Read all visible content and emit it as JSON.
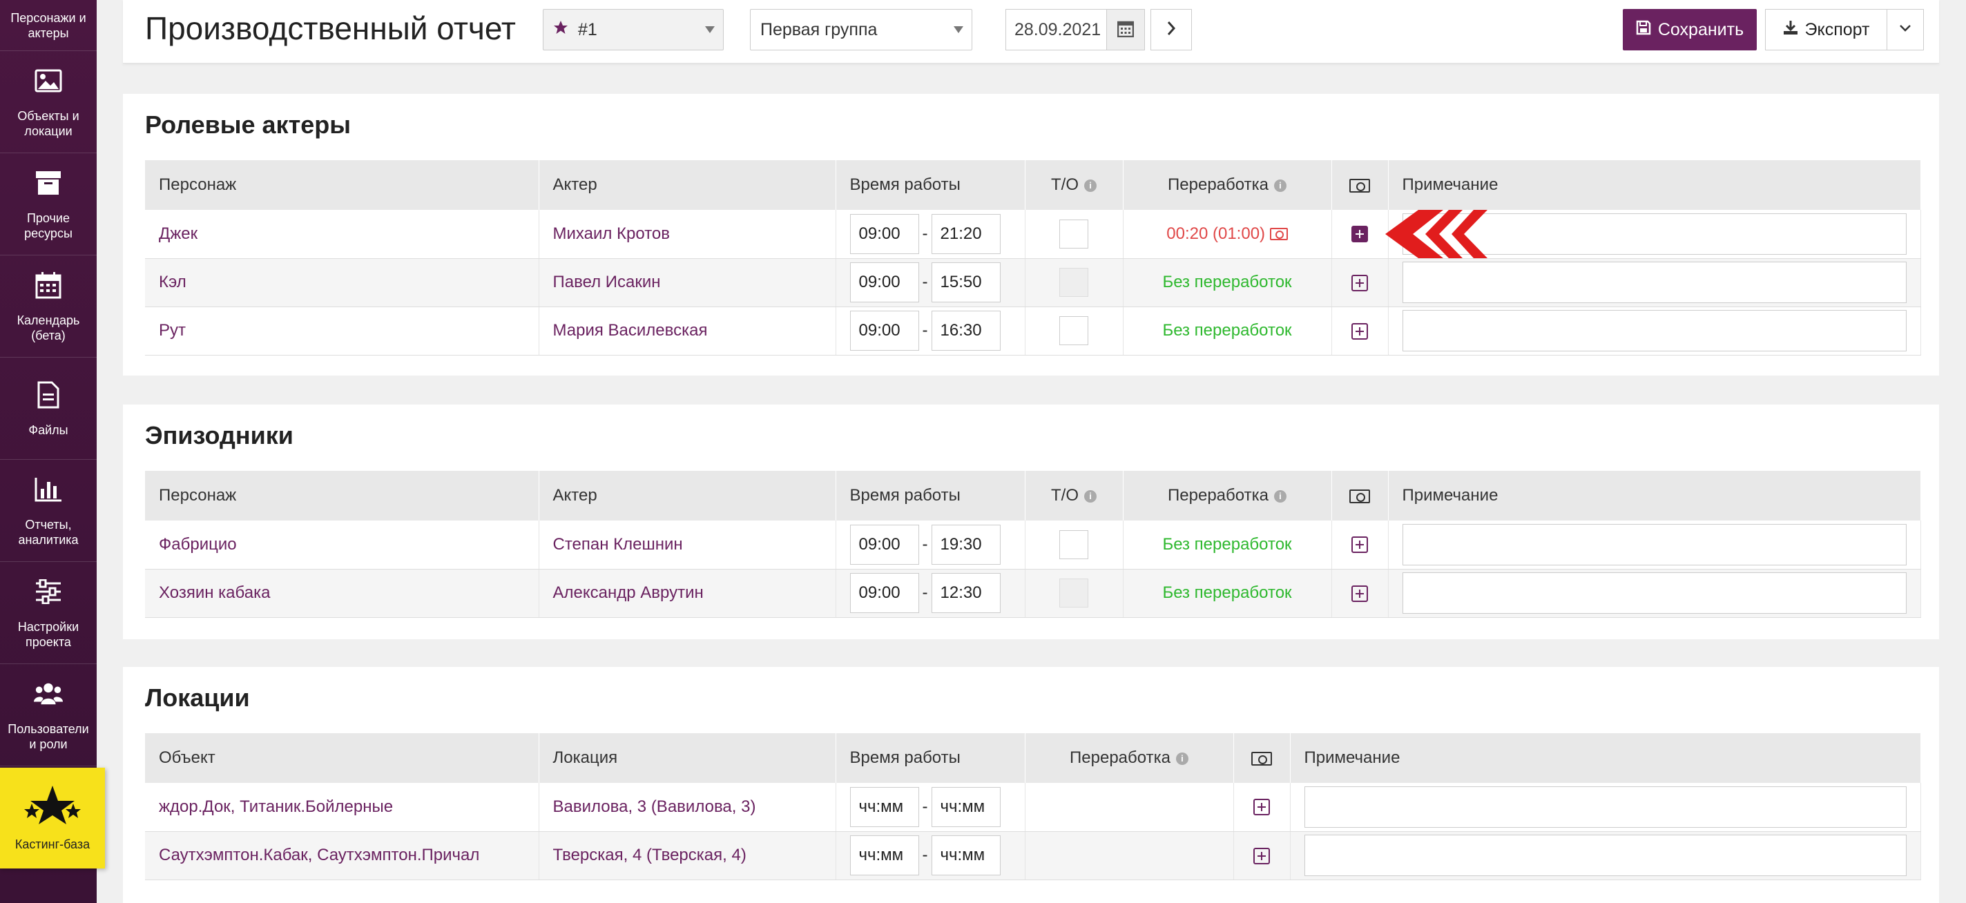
{
  "sidebar": {
    "items": [
      {
        "label": "Персонажи и актеры",
        "icon": "people-icon"
      },
      {
        "label": "Объекты и локации",
        "icon": "image-icon"
      },
      {
        "label": "Прочие ресурсы",
        "icon": "archive-icon"
      },
      {
        "label": "Календарь (бета)",
        "icon": "calendar-icon"
      },
      {
        "label": "Файлы",
        "icon": "file-icon"
      },
      {
        "label": "Отчеты, аналитика",
        "icon": "bar-chart-icon"
      },
      {
        "label": "Настройки проекта",
        "icon": "sliders-icon"
      },
      {
        "label": "Пользователи и роли",
        "icon": "users-icon"
      },
      {
        "label": "Кастинг-база",
        "icon": "stars-icon"
      }
    ]
  },
  "header": {
    "title": "Производственный отчет",
    "report_select": "#1",
    "group_select": "Первая группа",
    "date": "28.09.2021",
    "save_label": "Сохранить",
    "export_label": "Экспорт"
  },
  "actors": {
    "title": "Ролевые актеры",
    "columns": {
      "character": "Персонаж",
      "actor": "Актер",
      "work_time": "Время работы",
      "to": "Т/О",
      "overtime": "Переработка",
      "note": "Примечание"
    },
    "rows": [
      {
        "character": "Джек",
        "actor": "Михаил Кротов",
        "start": "09:00",
        "end": "21:20",
        "overtime": "00:20 (01:00)"
      },
      {
        "character": "Кэл",
        "actor": "Павел Исакин",
        "start": "09:00",
        "end": "15:50",
        "overtime": "Без переработок"
      },
      {
        "character": "Рут",
        "actor": "Мария Василевская",
        "start": "09:00",
        "end": "16:30",
        "overtime": "Без переработок"
      }
    ]
  },
  "extras": {
    "title": "Эпизодники",
    "columns": {
      "character": "Персонаж",
      "actor": "Актер",
      "work_time": "Время работы",
      "to": "Т/О",
      "overtime": "Переработка",
      "note": "Примечание"
    },
    "rows": [
      {
        "character": "Фабрицио",
        "actor": "Степан Клешнин",
        "start": "09:00",
        "end": "19:30",
        "overtime": "Без переработок"
      },
      {
        "character": "Хозяин кабака",
        "actor": "Александр Аврутин",
        "start": "09:00",
        "end": "12:30",
        "overtime": "Без переработок"
      }
    ]
  },
  "locations": {
    "title": "Локации",
    "columns": {
      "object": "Объект",
      "location": "Локация",
      "work_time": "Время работы",
      "overtime": "Переработка",
      "note": "Примечание"
    },
    "time_placeholder": "чч:мм",
    "rows": [
      {
        "object": "ждор.Док, Титаник.Бойлерные",
        "location": "Вавилова, 3 (Вавилова, 3)"
      },
      {
        "object": "Саутхэмптон.Кабак, Саутхэмптон.Причал",
        "location": "Тверская, 4 (Тверская, 4)"
      }
    ]
  },
  "colors": {
    "brand": "#6a2260",
    "ok": "#2eb82e",
    "overtime": "#e04848",
    "casting": "#f7e11b"
  }
}
